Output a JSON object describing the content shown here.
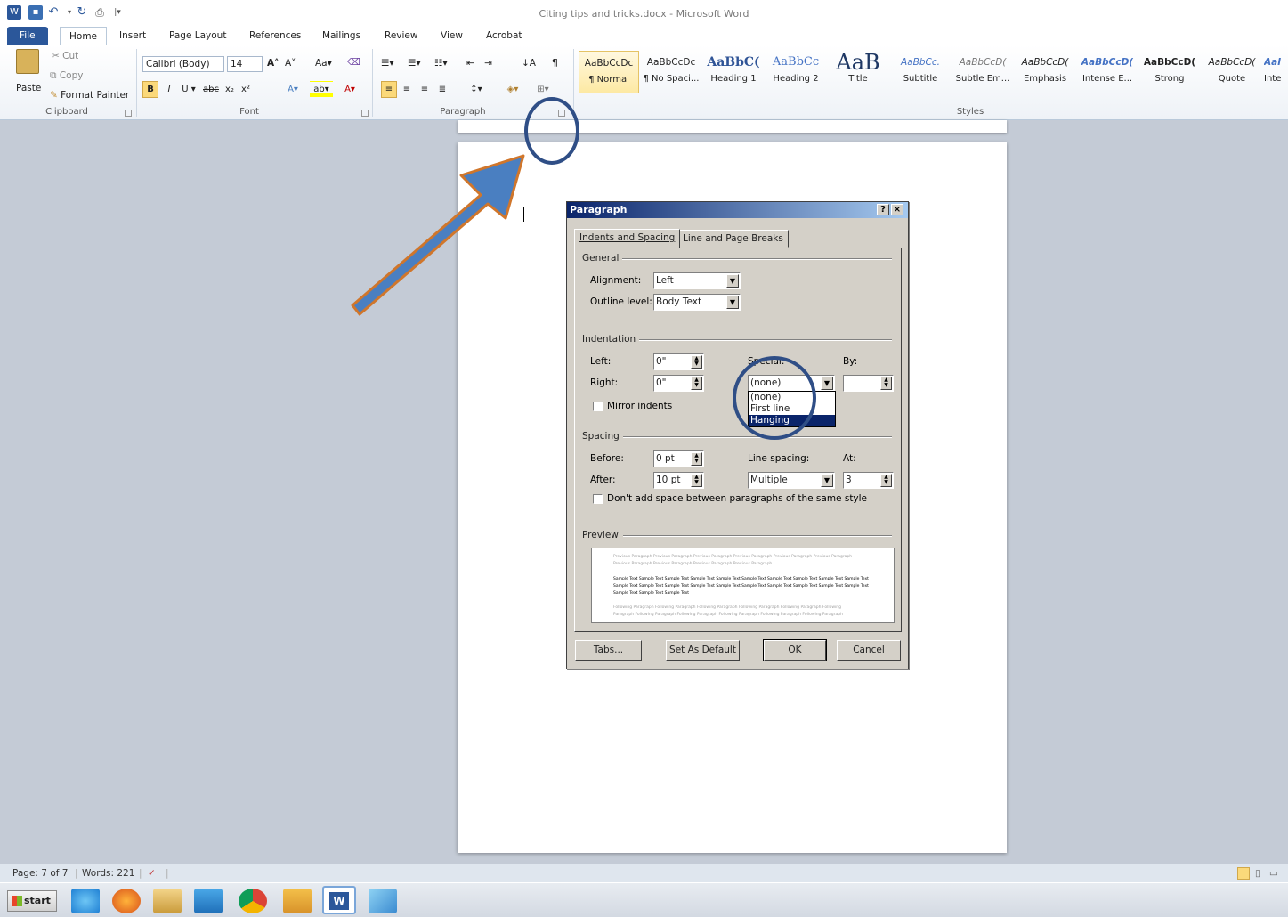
{
  "window": {
    "title": "Citing tips and tricks.docx - Microsoft Word"
  },
  "ribbon_tabs": [
    "File",
    "Home",
    "Insert",
    "Page Layout",
    "References",
    "Mailings",
    "Review",
    "View",
    "Acrobat"
  ],
  "clipboard": {
    "paste": "Paste",
    "cut": "Cut",
    "copy": "Copy",
    "format_painter": "Format Painter",
    "group_label": "Clipboard"
  },
  "font": {
    "name": "Calibri (Body)",
    "size": "14",
    "group_label": "Font"
  },
  "paragraph_group": {
    "group_label": "Paragraph"
  },
  "styles": {
    "group_label": "Styles",
    "items": [
      {
        "preview": "AaBbCcDc",
        "name": "¶ Normal"
      },
      {
        "preview": "AaBbCcDc",
        "name": "¶ No Spaci..."
      },
      {
        "preview": "AaBbC(",
        "name": "Heading 1"
      },
      {
        "preview": "AaBbCc",
        "name": "Heading 2"
      },
      {
        "preview": "AaB",
        "name": "Title"
      },
      {
        "preview": "AaBbCc.",
        "name": "Subtitle"
      },
      {
        "preview": "AaBbCcD(",
        "name": "Subtle Em..."
      },
      {
        "preview": "AaBbCcD(",
        "name": "Emphasis"
      },
      {
        "preview": "AaBbCcD(",
        "name": "Intense E..."
      },
      {
        "preview": "AaBbCcD(",
        "name": "Strong"
      },
      {
        "preview": "AaBbCcD(",
        "name": "Quote"
      },
      {
        "preview": "AaI",
        "name": "Inte"
      }
    ]
  },
  "dialog": {
    "title": "Paragraph",
    "help": "?",
    "close": "×",
    "tabs": [
      "Indents and Spacing",
      "Line and Page Breaks"
    ],
    "general": {
      "label": "General",
      "alignment_label": "Alignment:",
      "alignment_value": "Left",
      "outline_label": "Outline level:",
      "outline_value": "Body Text"
    },
    "indentation": {
      "label": "Indentation",
      "left_label": "Left:",
      "left_value": "0\"",
      "right_label": "Right:",
      "right_value": "0\"",
      "special_label": "Special:",
      "special_value": "(none)",
      "by_label": "By:",
      "by_value": "",
      "mirror_label": "Mirror indents",
      "special_options": [
        "(none)",
        "First line",
        "Hanging"
      ],
      "highlighted_option": "Hanging"
    },
    "spacing": {
      "label": "Spacing",
      "before_label": "Before:",
      "before_value": "0 pt",
      "after_label": "After:",
      "after_value": "10 pt",
      "line_spacing_label": "Line spacing:",
      "line_spacing_value": "Multiple",
      "at_label": "At:",
      "at_value": "3",
      "dont_add_label": "Don't add space between paragraphs of the same style"
    },
    "preview": {
      "label": "Preview",
      "prev_para_1": "Previous Paragraph Previous Paragraph Previous Paragraph Previous Paragraph Previous Paragraph Previous Paragraph",
      "prev_para_2": "Previous Paragraph Previous Paragraph Previous Paragraph Previous Paragraph",
      "sample_1": "Sample Text Sample Text Sample Text Sample Text Sample Text Sample Text Sample Text Sample Text Sample Text Sample Text",
      "sample_2": "Sample Text Sample Text Sample Text Sample Text Sample Text Sample Text Sample Text Sample Text Sample Text Sample Text",
      "sample_3": "Sample Text Sample Text Sample Text",
      "follow_1": "Following Paragraph Following Paragraph Following Paragraph Following Paragraph Following Paragraph Following",
      "follow_2": "Paragraph Following Paragraph Following Paragraph Following Paragraph Following Paragraph Following Paragraph"
    },
    "buttons": {
      "tabs": "Tabs...",
      "set_default": "Set As Default",
      "ok": "OK",
      "cancel": "Cancel"
    }
  },
  "status": {
    "page": "Page: 7 of 7",
    "words": "Words: 221"
  },
  "taskbar": {
    "start": "start"
  },
  "colors": {
    "file_tab": "#2b579a",
    "annotation": "#2f4e86",
    "arrow_fill": "#4a7fc1",
    "arrow_stroke": "#d0762b",
    "highlight": "#0a246a"
  }
}
